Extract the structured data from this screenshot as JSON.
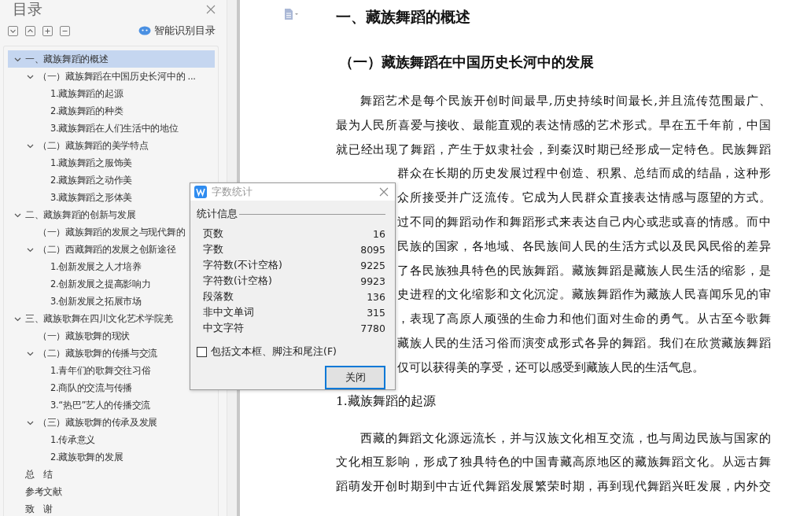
{
  "sidebar": {
    "title": "目录",
    "smart_toc": "智能识别目录",
    "toc": [
      {
        "label": "一、藏族舞蹈的概述",
        "selected": true,
        "expanded": true,
        "children": [
          {
            "label": "（一）藏族舞蹈在中国历史长河中的 ...",
            "selected": false,
            "expanded": true,
            "children": [
              {
                "label": "1.藏族舞蹈的起源",
                "selected": false
              },
              {
                "label": "2.藏族舞蹈的种类",
                "selected": false
              },
              {
                "label": "3.藏族舞蹈在人们生活中的地位",
                "selected": false
              }
            ]
          },
          {
            "label": "（二）藏族舞蹈的美学特点",
            "selected": false,
            "expanded": true,
            "children": [
              {
                "label": "1.藏族舞蹈之服饰美",
                "selected": false
              },
              {
                "label": "2.藏族舞蹈之动作美",
                "selected": false
              },
              {
                "label": "3.藏族舞蹈之形体美",
                "selected": false
              }
            ]
          }
        ]
      },
      {
        "label": "二、藏族舞蹈的创新与发展",
        "selected": false,
        "expanded": true,
        "children": [
          {
            "label": "（一）藏族舞蹈的发展之与现代舞的",
            "selected": false
          },
          {
            "label": "（二）西藏舞蹈的发展之创新途径",
            "selected": false,
            "expanded": true,
            "children": [
              {
                "label": "1.创新发展之人才培养",
                "selected": false
              },
              {
                "label": "2.创新发展之提高影响力",
                "selected": false
              },
              {
                "label": "3.创新发展之拓展市场",
                "selected": false
              }
            ]
          }
        ]
      },
      {
        "label": "三、藏族歌舞在四川文化艺术学院羌",
        "selected": false,
        "expanded": true,
        "children": [
          {
            "label": "（一）藏族歌舞的现状",
            "selected": false
          },
          {
            "label": "（二）藏族歌舞的传播与交流",
            "selected": false,
            "expanded": true,
            "children": [
              {
                "label": "1.青年们的歌舞交往习俗",
                "selected": false
              },
              {
                "label": "2.商队的交流与传播",
                "selected": false
              },
              {
                "label": "3.“热巴”艺人的传播交流",
                "selected": false
              }
            ]
          },
          {
            "label": "（三）藏族歌舞的传承及发展",
            "selected": false,
            "expanded": true,
            "children": [
              {
                "label": "1.传承意义",
                "selected": false
              },
              {
                "label": "2.藏族歌舞的发展",
                "selected": false
              }
            ]
          }
        ]
      },
      {
        "label": "总　结",
        "selected": false
      },
      {
        "label": "参考文献",
        "selected": false
      },
      {
        "label": "致　谢",
        "selected": false
      }
    ]
  },
  "document": {
    "blocks": [
      {
        "kind": "h1",
        "text": "一、藏族舞蹈的概述"
      },
      {
        "kind": "h2",
        "text": "（一）藏族舞蹈在中国历史长河中的发展"
      },
      {
        "kind": "line",
        "indent": true,
        "text": "舞蹈艺术是每个民族开创时间最早,历史持续时间最长,并且流传范围最广、"
      },
      {
        "kind": "line",
        "text": "最为人民所喜爱与接收、最能直观的表达情感的艺术形式。早在五千年前，中国"
      },
      {
        "kind": "line",
        "text": "就已经出现了舞蹈，产生于奴隶社会，到秦汉时期已经形成一定特色。民族舞蹈"
      },
      {
        "kind": "line",
        "covered": true,
        "text": "群众在长期的历史发展过程中创造、积累、总结而成的结晶，这种形"
      },
      {
        "kind": "line",
        "covered": true,
        "text": "众所接受并广泛流传。它成为人民群众直接表达情感与愿望的方式。"
      },
      {
        "kind": "line",
        "covered": true,
        "text": "过不同的舞蹈动作和舞蹈形式来表达自己内心或悲或喜的情感。而中"
      },
      {
        "kind": "line",
        "covered": true,
        "text": "民族的国家，各地域、各民族间人民的生活方式以及民风民俗的差异"
      },
      {
        "kind": "line",
        "covered": true,
        "text": "了各民族独具特色的民族舞蹈。藏族舞蹈是藏族人民生活的缩影，是"
      },
      {
        "kind": "line",
        "covered": true,
        "text": "史进程的文化缩影和文化沉淀。藏族舞蹈作为藏族人民喜闻乐见的审"
      },
      {
        "kind": "line",
        "covered": true,
        "text": "，表现了高原人顽强的生命力和他们面对生命的勇气。从古至今歌舞"
      },
      {
        "kind": "line",
        "covered": true,
        "text": "藏族人民的生活习俗而演变成形式各异的舞蹈。我们在欣赏藏族舞蹈"
      },
      {
        "kind": "line",
        "covered": true,
        "last": true,
        "text": "仅可以获得美的享受，还可以感受到藏族人民的生活气息。"
      },
      {
        "kind": "h3",
        "text": "1.藏族舞蹈的起源"
      },
      {
        "kind": "line",
        "indent": true,
        "text": "西藏的舞蹈文化源远流长，并与汉族文化相互交流，也与周边民族与国家的"
      },
      {
        "kind": "line",
        "text": "文化相互影响，形成了独具特色的中国青藏高原地区的藏族舞蹈文化。从远古舞"
      },
      {
        "kind": "line",
        "text": "蹈萌发开创时期到中古近代舞蹈发展繁荣时期，再到现代舞蹈兴旺发展，内外交"
      }
    ]
  },
  "dialog": {
    "title": "字数统计",
    "group": "统计信息",
    "stats": [
      {
        "label": "页数",
        "value": "16"
      },
      {
        "label": "字数",
        "value": "8095"
      },
      {
        "label": "字符数(不计空格)",
        "value": "9225"
      },
      {
        "label": "字符数(计空格)",
        "value": "9923"
      },
      {
        "label": "段落数",
        "value": "136"
      },
      {
        "label": "非中文单词",
        "value": "315"
      },
      {
        "label": "中文字符",
        "value": "7780"
      }
    ],
    "option": {
      "label": "包括文本框、脚注和尾注(F)",
      "checked": false
    },
    "button": "关闭"
  }
}
